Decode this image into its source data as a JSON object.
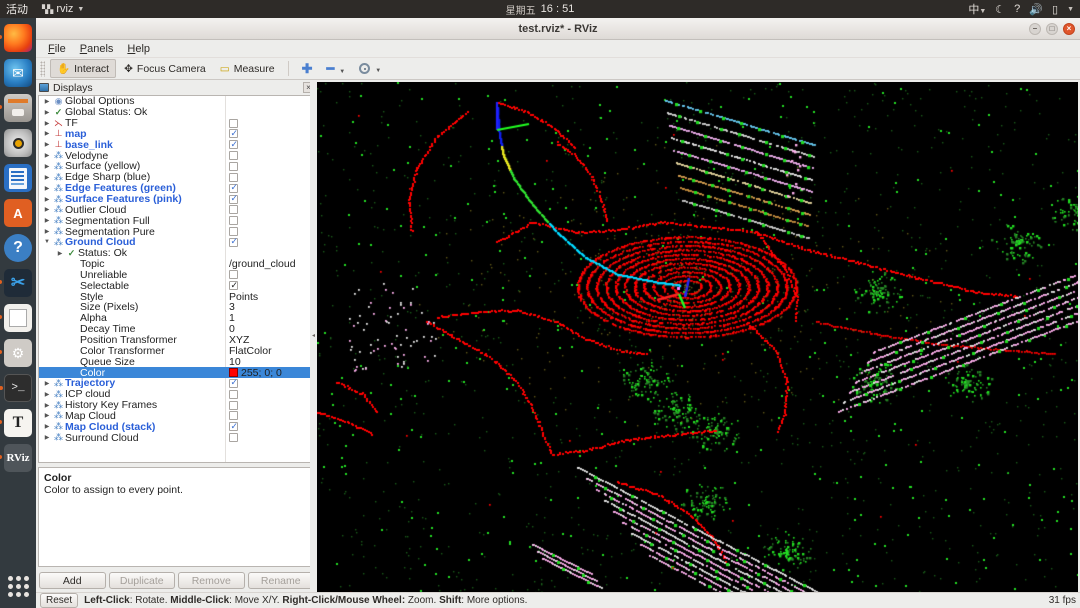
{
  "desktop": {
    "activities": "活动",
    "app_menu": "rviz",
    "clock_weekday": "星期五",
    "clock_time": "16 : 51",
    "tray": {
      "input_method": "中",
      "night_mode_icon": "moon-icon",
      "help_icon": "question-icon",
      "volume_icon": "speaker-icon",
      "battery_icon": "battery-icon"
    },
    "launcher": [
      {
        "name": "firefox",
        "label": "Firefox",
        "running": true
      },
      {
        "name": "thunderbird",
        "label": "Thunderbird",
        "running": false
      },
      {
        "name": "files",
        "label": "Files",
        "running": true
      },
      {
        "name": "rhythmbox",
        "label": "Rhythmbox",
        "running": false
      },
      {
        "name": "writer",
        "label": "LibreOffice Writer",
        "running": false
      },
      {
        "name": "software",
        "label": "Ubuntu Software",
        "running": false
      },
      {
        "name": "help",
        "label": "Help",
        "running": false
      },
      {
        "name": "vscode",
        "label": "Visual Studio Code",
        "running": true
      },
      {
        "name": "notes",
        "label": "Notes",
        "running": true
      },
      {
        "name": "settings",
        "label": "Settings",
        "running": true
      },
      {
        "name": "terminal",
        "label": "Terminal",
        "running": true
      },
      {
        "name": "texmaker",
        "label": "Texmaker",
        "running": true
      },
      {
        "name": "rviz",
        "label": "RViz",
        "running": true
      }
    ],
    "show_apps": "show-applications"
  },
  "window": {
    "title": "test.rviz* - RViz",
    "buttons": {
      "minimize": "–",
      "maximize": "□",
      "close": "×"
    }
  },
  "menubar": [
    {
      "label": "File"
    },
    {
      "label": "Panels"
    },
    {
      "label": "Help"
    }
  ],
  "toolbar": {
    "interact": "Interact",
    "focus_camera": "Focus Camera",
    "measure": "Measure",
    "add_icon": "plus-icon",
    "remove_icon": "minus-icon",
    "view_icon": "eye-icon"
  },
  "displays_panel": {
    "title": "Displays",
    "close_label": "×",
    "tree": [
      {
        "label": "Global Options",
        "icon": "globe-icon",
        "indent": 0,
        "arrow": true,
        "bold": false,
        "checkbox": null
      },
      {
        "label": "Global Status: Ok",
        "icon": "check-icon",
        "indent": 0,
        "arrow": true,
        "bold": false,
        "checkbox": null
      },
      {
        "label": "TF",
        "icon": "tf-icon",
        "indent": 0,
        "arrow": true,
        "bold": false,
        "checkbox": false
      },
      {
        "label": "map",
        "icon": "axes-icon",
        "indent": 0,
        "arrow": true,
        "bold": true,
        "checkbox": true
      },
      {
        "label": "base_link",
        "icon": "axes-icon",
        "indent": 0,
        "arrow": true,
        "bold": true,
        "checkbox": true
      },
      {
        "label": "Velodyne",
        "icon": "cloud-icon",
        "indent": 0,
        "arrow": true,
        "bold": false,
        "checkbox": false
      },
      {
        "label": "Surface (yellow)",
        "icon": "cloud-icon",
        "indent": 0,
        "arrow": true,
        "bold": false,
        "checkbox": false
      },
      {
        "label": "Edge Sharp (blue)",
        "icon": "cloud-icon",
        "indent": 0,
        "arrow": true,
        "bold": false,
        "checkbox": false
      },
      {
        "label": "Edge Features (green)",
        "icon": "cloud-icon",
        "indent": 0,
        "arrow": true,
        "bold": true,
        "checkbox": true
      },
      {
        "label": "Surface Features (pink)",
        "icon": "cloud-icon",
        "indent": 0,
        "arrow": true,
        "bold": true,
        "checkbox": true
      },
      {
        "label": "Outlier Cloud",
        "icon": "cloud-icon",
        "indent": 0,
        "arrow": true,
        "bold": false,
        "checkbox": false
      },
      {
        "label": "Segmentation Full",
        "icon": "cloud-icon",
        "indent": 0,
        "arrow": true,
        "bold": false,
        "checkbox": false
      },
      {
        "label": "Segmentation Pure",
        "icon": "cloud-icon",
        "indent": 0,
        "arrow": true,
        "bold": false,
        "checkbox": false
      },
      {
        "label": "Ground Cloud",
        "icon": "cloud-icon",
        "indent": 0,
        "arrow": "down",
        "bold": true,
        "checkbox": true
      },
      {
        "label": "Status: Ok",
        "icon": "check-icon",
        "indent": 1,
        "arrow": true,
        "bold": false,
        "checkbox": null
      },
      {
        "label": "Topic",
        "icon": null,
        "indent": 2,
        "arrow": false,
        "bold": false,
        "value": "/ground_cloud"
      },
      {
        "label": "Unreliable",
        "icon": null,
        "indent": 2,
        "arrow": false,
        "bold": false,
        "checkbox": false,
        "darkcb": true
      },
      {
        "label": "Selectable",
        "icon": null,
        "indent": 2,
        "arrow": false,
        "bold": false,
        "checkbox": true,
        "darkcb": true
      },
      {
        "label": "Style",
        "icon": null,
        "indent": 2,
        "arrow": false,
        "bold": false,
        "value": "Points"
      },
      {
        "label": "Size (Pixels)",
        "icon": null,
        "indent": 2,
        "arrow": false,
        "bold": false,
        "value": "3"
      },
      {
        "label": "Alpha",
        "icon": null,
        "indent": 2,
        "arrow": false,
        "bold": false,
        "value": "1"
      },
      {
        "label": "Decay Time",
        "icon": null,
        "indent": 2,
        "arrow": false,
        "bold": false,
        "value": "0"
      },
      {
        "label": "Position Transformer",
        "icon": null,
        "indent": 2,
        "arrow": false,
        "bold": false,
        "value": "XYZ"
      },
      {
        "label": "Color Transformer",
        "icon": null,
        "indent": 2,
        "arrow": false,
        "bold": false,
        "value": "FlatColor"
      },
      {
        "label": "Queue Size",
        "icon": null,
        "indent": 2,
        "arrow": false,
        "bold": false,
        "value": "10"
      },
      {
        "label": "Color",
        "icon": null,
        "indent": 2,
        "arrow": false,
        "bold": false,
        "value": "255; 0; 0",
        "swatch": "#ff0000",
        "selected": true
      },
      {
        "label": "Trajectory",
        "icon": "cloud-icon",
        "indent": 0,
        "arrow": true,
        "bold": true,
        "checkbox": true
      },
      {
        "label": "ICP cloud",
        "icon": "cloud-icon",
        "indent": 0,
        "arrow": true,
        "bold": false,
        "checkbox": false
      },
      {
        "label": "History Key Frames",
        "icon": "cloud-icon",
        "indent": 0,
        "arrow": true,
        "bold": false,
        "checkbox": false
      },
      {
        "label": "Map Cloud",
        "icon": "cloud-icon",
        "indent": 0,
        "arrow": true,
        "bold": false,
        "checkbox": false
      },
      {
        "label": "Map Cloud (stack)",
        "icon": "cloud-icon",
        "indent": 0,
        "arrow": true,
        "bold": true,
        "checkbox": true
      },
      {
        "label": "Surround Cloud",
        "icon": "cloud-icon",
        "indent": 0,
        "arrow": true,
        "bold": false,
        "checkbox": false
      }
    ],
    "description": {
      "title": "Color",
      "text": "Color to assign to every point."
    },
    "buttons": [
      {
        "label": "Add",
        "enabled": true
      },
      {
        "label": "Duplicate",
        "enabled": false
      },
      {
        "label": "Remove",
        "enabled": false
      },
      {
        "label": "Rename",
        "enabled": false
      }
    ]
  },
  "statusbar": {
    "reset": "Reset",
    "hint_parts": [
      {
        "text": "Left-Click",
        "bold": true
      },
      {
        "text": ": Rotate.  ",
        "bold": false
      },
      {
        "text": "Middle-Click",
        "bold": true
      },
      {
        "text": ": Move X/Y.  ",
        "bold": false
      },
      {
        "text": "Right-Click/Mouse Wheel:",
        "bold": true
      },
      {
        "text": " Zoom.  ",
        "bold": false
      },
      {
        "text": "Shift",
        "bold": true
      },
      {
        "text": ": More options.",
        "bold": false
      }
    ],
    "fps": "31 fps"
  },
  "viewport": {
    "background": "#000000",
    "colors": {
      "ground_cloud": "#ff0000",
      "edge_features": "#22dd22",
      "surface_features": "#ffb0ee",
      "map_cloud_stack": "#e8e8e8",
      "trajectory": "#00d8ff",
      "tf_x": "#ff2222",
      "tf_y": "#22ff22",
      "tf_z": "#2222ff"
    }
  }
}
